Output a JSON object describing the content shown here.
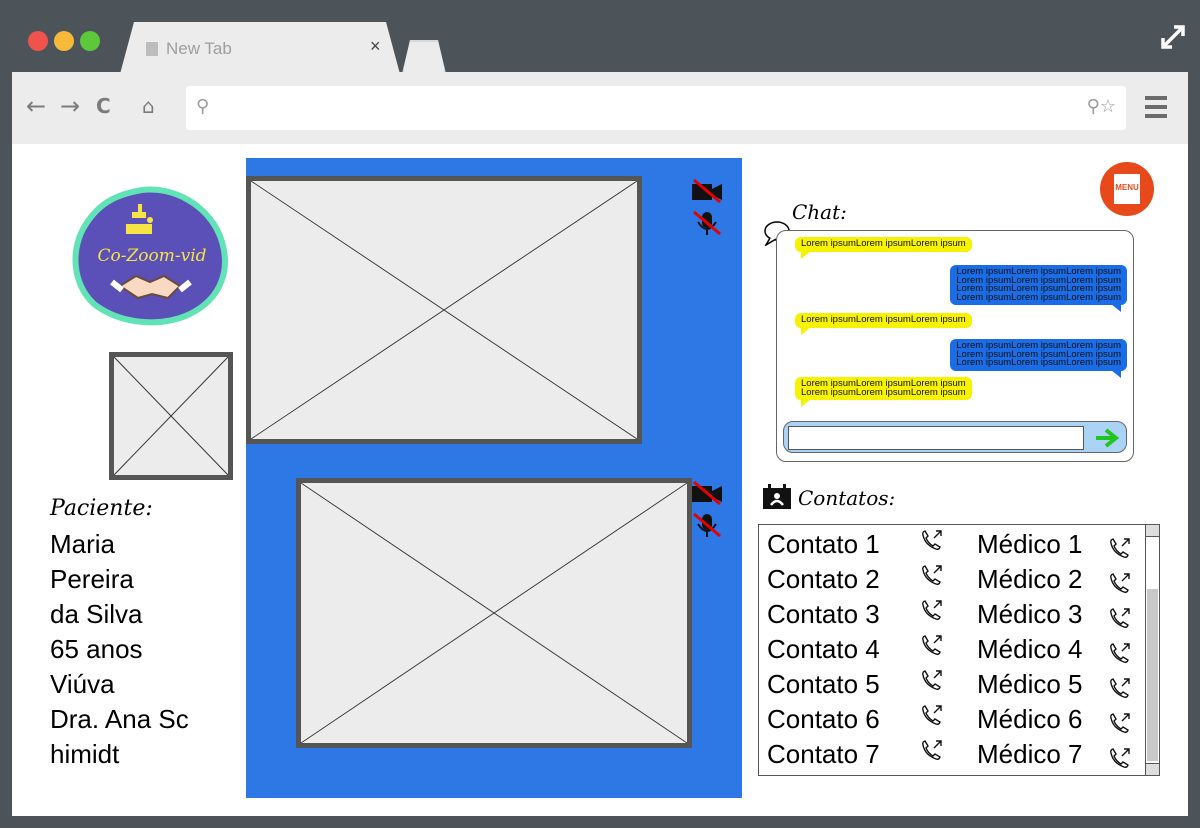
{
  "browser": {
    "tab_title": "New Tab",
    "tab_close": "×",
    "expand_icon": "expand-icon",
    "url_value": "",
    "url_icons": "⚲☆"
  },
  "logo": {
    "text": "Co-Zoom-vid"
  },
  "patient": {
    "heading": "Paciente:",
    "lines": [
      "Maria",
      "Pereira",
      "da Silva",
      "65 anos",
      "Viúva",
      "Dra. Ana Sc",
      "himidt"
    ]
  },
  "menu": {
    "label": "MENU"
  },
  "chat": {
    "title": "Chat:",
    "input_value": "",
    "messages": [
      {
        "side": "left",
        "color": "yellow",
        "lines": [
          "Lorem ipsumLorem ipsumLorem ipsum"
        ]
      },
      {
        "side": "right",
        "color": "blue",
        "lines": [
          "Lorem ipsumLorem ipsumLorem ipsum",
          "Lorem ipsumLorem ipsumLorem ipsum",
          "Lorem ipsumLorem ipsumLorem ipsum",
          "Lorem ipsumLorem ipsumLorem ipsum"
        ]
      },
      {
        "side": "left",
        "color": "yellow",
        "lines": [
          "Lorem ipsumLorem ipsumLorem ipsum"
        ]
      },
      {
        "side": "right",
        "color": "blue",
        "lines": [
          "Lorem ipsumLorem ipsumLorem ipsum",
          "Lorem ipsumLorem ipsumLorem ipsum",
          "Lorem ipsumLorem ipsumLorem ipsum"
        ]
      },
      {
        "side": "left",
        "color": "yellow",
        "lines": [
          "Lorem ipsumLorem ipsumLorem ipsum",
          "Lorem ipsumLorem ipsumLorem ipsum"
        ]
      }
    ]
  },
  "contacts": {
    "title": "Contatos:",
    "rows": [
      {
        "contact": "Contato 1",
        "doctor": "Médico 1"
      },
      {
        "contact": "Contato 2",
        "doctor": "Médico 2"
      },
      {
        "contact": "Contato 3",
        "doctor": "Médico 3"
      },
      {
        "contact": "Contato 4",
        "doctor": "Médico 4"
      },
      {
        "contact": "Contato 5",
        "doctor": "Médico 5"
      },
      {
        "contact": "Contato 6",
        "doctor": "Médico 6"
      },
      {
        "contact": "Contato 7",
        "doctor": "Médico 7"
      }
    ]
  },
  "colors": {
    "video_panel": "#2e78e6",
    "chat_yellow": "#f6f200",
    "chat_blue": "#1a6de6",
    "menu": "#e8491b",
    "send": "#22c422",
    "logo_bg": "#5b4fb8",
    "logo_border": "#62e3b5"
  }
}
